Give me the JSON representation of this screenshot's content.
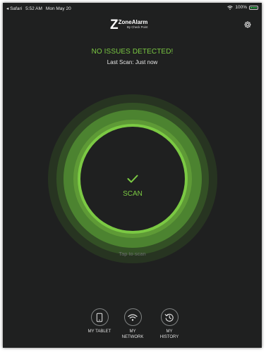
{
  "statusbar": {
    "back_app": "Safari",
    "time": "5:52 AM",
    "date": "Mon May 20",
    "battery_percent": "100%",
    "battery_glyph": "100"
  },
  "header": {
    "logo_main": "ZoneAlarm",
    "logo_sub": "By Check Point"
  },
  "status": {
    "title": "NO ISSUES DETECTED!",
    "last_scan": "Last Scan: Just now"
  },
  "scan": {
    "label": "SCAN",
    "hint": "Tap to scan"
  },
  "nav": {
    "items": [
      {
        "label": "MY TABLET",
        "icon": "tablet-icon"
      },
      {
        "label": "MY\nNETWORK",
        "icon": "wifi-icon"
      },
      {
        "label": "MY\nHISTORY",
        "icon": "history-icon"
      }
    ]
  },
  "colors": {
    "background": "#1f2020",
    "accent_green": "#7bc943",
    "ring_green": "#4f8a2b"
  }
}
